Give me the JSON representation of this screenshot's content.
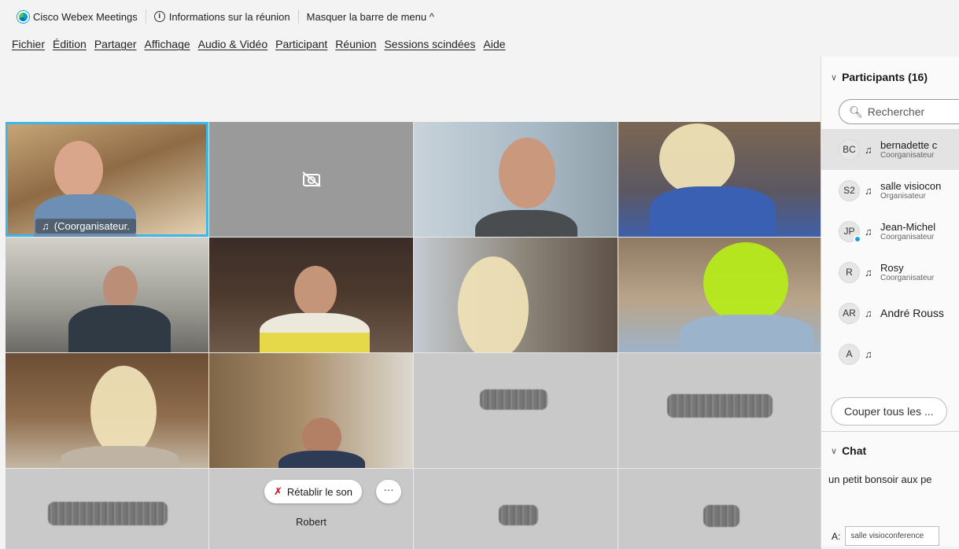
{
  "titlebar": {
    "app_name": "Cisco Webex Meetings",
    "info_label": "Informations sur la réunion",
    "hide_menu_label": "Masquer la barre de menu ^"
  },
  "menu": [
    "Fichier",
    "Édition",
    "Partager",
    "Affichage",
    "Audio & Vidéo",
    "Participant",
    "Réunion",
    "Sessions scindées",
    "Aide"
  ],
  "video": {
    "active_tile_label": "(Coorganisateur.",
    "restore_sound_label": "Rétablir le son",
    "more_label": "···",
    "robert_name": "Robert",
    "accent_color": "#3fb7e6"
  },
  "participants": {
    "header": "Participants (16)",
    "search_placeholder": "Rechercher",
    "list": [
      {
        "initials": "BC",
        "name": "bernadette c",
        "role": "Coorganisateur"
      },
      {
        "initials": "S2",
        "name": "salle visiocon",
        "role": "Organisateur"
      },
      {
        "initials": "JP",
        "name": "Jean-Michel",
        "role": "Coorganisateur"
      },
      {
        "initials": "R",
        "name": "Rosy",
        "role": "Coorganisateur"
      },
      {
        "initials": "AR",
        "name": "André Rouss",
        "role": ""
      },
      {
        "initials": "A",
        "name": "",
        "role": ""
      }
    ],
    "mute_all_label": "Couper tous les ..."
  },
  "chat": {
    "header": "Chat",
    "message": "un petit bonsoir aux pe",
    "to_label": "A:",
    "to_value": "salle visioconference"
  }
}
